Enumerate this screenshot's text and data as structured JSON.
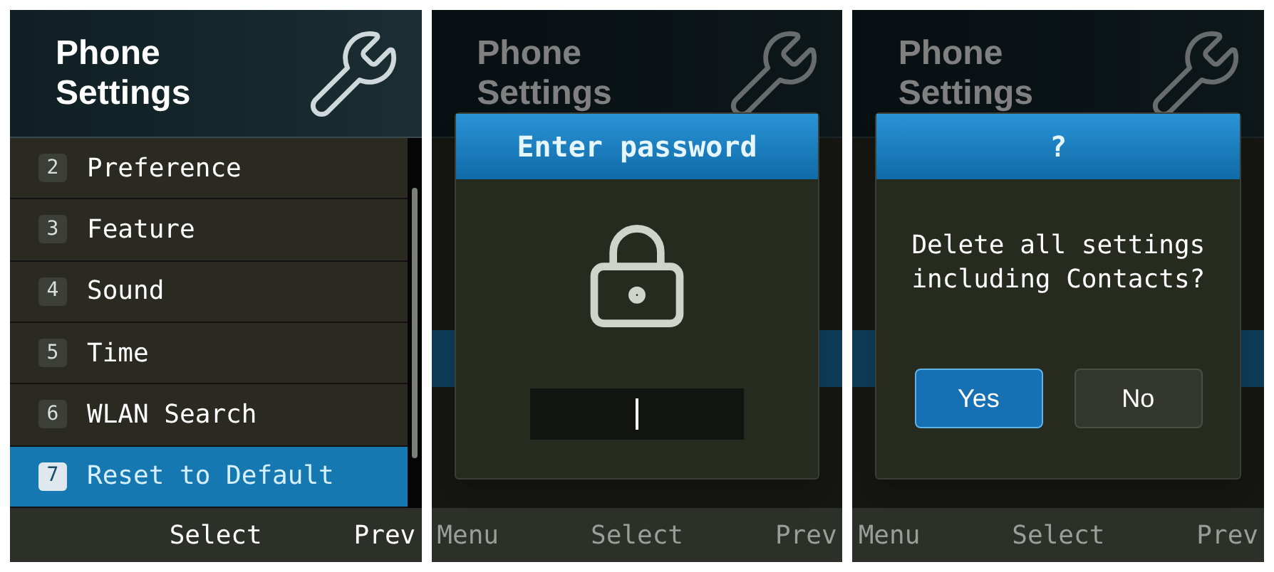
{
  "screens": [
    {
      "kind": "menu",
      "header": {
        "title_lines": [
          "Phone",
          "Settings"
        ]
      },
      "items": [
        {
          "number": "2",
          "label": "Preference",
          "selected": false
        },
        {
          "number": "3",
          "label": "Feature",
          "selected": false
        },
        {
          "number": "4",
          "label": "Sound",
          "selected": false
        },
        {
          "number": "5",
          "label": "Time",
          "selected": false
        },
        {
          "number": "6",
          "label": "WLAN Search",
          "selected": false
        },
        {
          "number": "7",
          "label": "Reset to Default",
          "selected": true
        }
      ],
      "softkeys": {
        "center": "Select",
        "right": "Prev"
      }
    },
    {
      "kind": "password",
      "header": {
        "title_lines": [
          "Phone",
          "Settings"
        ]
      },
      "dialog": {
        "title": "Enter password"
      },
      "softkeys": {
        "left": "Menu",
        "center": "Select",
        "right": "Prev"
      }
    },
    {
      "kind": "confirm",
      "header": {
        "title_lines": [
          "Phone",
          "Settings"
        ]
      },
      "dialog": {
        "title": "?",
        "message": "Delete all settings including Contacts?",
        "buttons": [
          {
            "label": "Yes",
            "selected": true
          },
          {
            "label": "No",
            "selected": false
          }
        ]
      },
      "softkeys": {
        "left": "Menu",
        "center": "Select",
        "right": "Prev"
      }
    }
  ]
}
